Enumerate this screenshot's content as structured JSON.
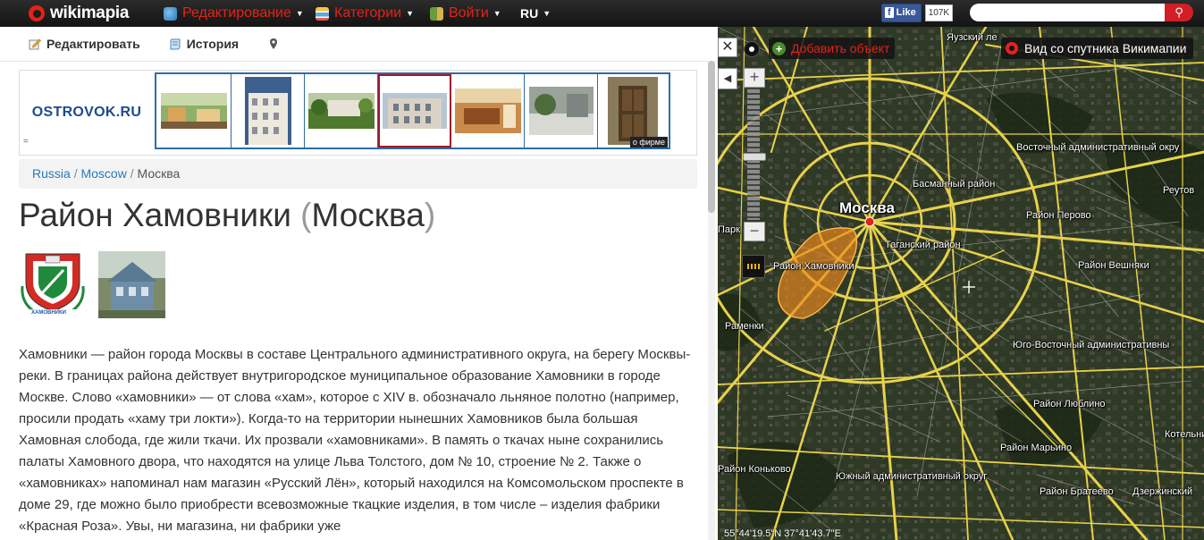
{
  "topbar": {
    "logo_text": "wikimapia",
    "menus": [
      {
        "label": "Редактирование",
        "icon": "globe-pencil-icon"
      },
      {
        "label": "Категории",
        "icon": "categories-list-icon"
      },
      {
        "label": "Войти",
        "icon": "login-door-icon"
      }
    ],
    "language": "RU",
    "facebook": {
      "like_label": "Like",
      "count": "107K"
    },
    "search": {
      "value": "",
      "button_icon": "search-icon"
    },
    "colors": {
      "accent": "#e2231a",
      "bar": "#1c1c1c"
    }
  },
  "toolbar": {
    "edit_label": "Редактировать",
    "history_label": "История",
    "location_icon": "map-pin-icon"
  },
  "ad": {
    "brand": "OSTROVOK.RU",
    "about_label": "о фирме",
    "menu_glyph": "="
  },
  "breadcrumb": {
    "items": [
      "Russia",
      "Moscow",
      "Москва"
    ],
    "separator": "/"
  },
  "place": {
    "title": "Район Хамовники",
    "parent_open": "(",
    "parent": "Москва",
    "parent_close": ")",
    "coat_caption": "ХАМОВНИКИ",
    "description": "Хамовники — район города Москвы в составе Центрального административного округа, на берегу Москвы-реки. В границах района действует внутригородское муниципальное образование Хамовники в городе Москве. Слово «хамовники» — от слова «хам», которое с XIV в. обозначало льняное полотно (например, просили продать «хаму три локти»). Когда-то на территории нынешних Хамовников была большая Хамовная слобода, где жили ткачи. Их прозвали «хамовниками». В память о ткачах ныне сохранились палаты Хамовного двора, что находятся на улице Льва Толстого, дом № 10, строение № 2. Также о «хамовниках» напоминал нам магазин «Русский Лён», который находился на Комсомольском проспекте в доме 29, где можно было приобрести всевозможные ткацкие изделия, в том числе – изделия фабрики «Красная Роза». Увы, ни магазина, ни фабрики уже"
  },
  "map": {
    "close_glyph": "✕",
    "collapse_glyph": "◀",
    "add_object_label": "Добавить объект",
    "satellite_label": "Вид со спутника Викимапии",
    "zoom_in": "+",
    "zoom_out": "−",
    "coords": "55°44'19.5\"N 37°41'43.7\"E",
    "road_color": "#e8d24a",
    "district_color": "#f08a1c",
    "labels": {
      "yauzsky": "Яузский ле",
      "vostochny": "Восточный административный окру",
      "basmanny": "Басманный район",
      "moskva": "Москва",
      "sokolniki_pk": "Парк",
      "reutov": "Реутов",
      "perovo": "Район Перово",
      "tagansky": "Таганский район",
      "khamovniki": "Район Хамовники",
      "veshnyaki": "Район Вешняки",
      "ramenki": "Раменки",
      "yugo_vostochny": "Юго-Восточный административны",
      "lyublino": "Район Люблино",
      "kotelniki": "Котельни",
      "maryino": "Район Марьино",
      "konkovo": "Район Коньково",
      "yuzhny": "Южный административный округ",
      "brateevo": "Район Братеево",
      "dzerzhinsky": "Дзержинский"
    }
  }
}
